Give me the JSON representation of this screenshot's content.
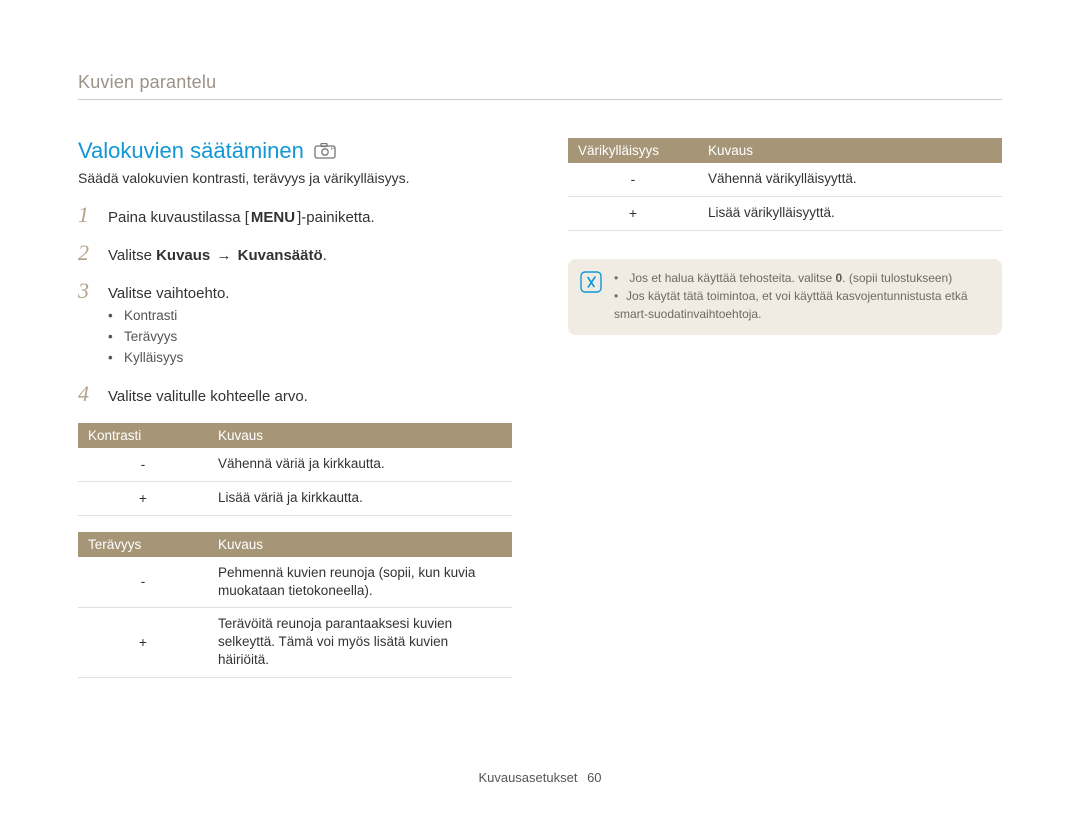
{
  "breadcrumb": "Kuvien parantelu",
  "section": {
    "title": "Valokuvien säätäminen"
  },
  "subtitle": "Säädä valokuvien kontrasti, terävyys ja värikylläisyys.",
  "steps": [
    {
      "num": "1",
      "pre": "Paina kuvaustilassa [",
      "badge": "MENU",
      "post": "]-painiketta."
    },
    {
      "num": "2",
      "pre": "Valitse ",
      "bold1": "Kuvaus",
      "arrow": "→",
      "bold2": "Kuvansäätö",
      "tail": "."
    },
    {
      "num": "3",
      "pre": "Valitse vaihtoehto.",
      "bullets": [
        "Kontrasti",
        "Terävyys",
        "Kylläisyys"
      ]
    },
    {
      "num": "4",
      "pre": "Valitse valitulle kohteelle arvo."
    }
  ],
  "tables": {
    "kontrasti": {
      "head1": "Kontrasti",
      "head2": "Kuvaus",
      "rows": [
        {
          "sign": "-",
          "desc": "Vähennä väriä ja kirkkautta."
        },
        {
          "sign": "+",
          "desc": "Lisää väriä ja kirkkautta."
        }
      ]
    },
    "teravyys": {
      "head1": "Terävyys",
      "head2": "Kuvaus",
      "rows": [
        {
          "sign": "-",
          "desc": "Pehmennä kuvien reunoja (sopii, kun kuvia muokataan tietokoneella)."
        },
        {
          "sign": "+",
          "desc": "Terävöitä reunoja parantaaksesi kuvien selkeyttä. Tämä voi myös lisätä kuvien häiriöitä."
        }
      ]
    },
    "vari": {
      "head1": "Värikylläisyys",
      "head2": "Kuvaus",
      "rows": [
        {
          "sign": "-",
          "desc": "Vähennä värikylläisyyttä."
        },
        {
          "sign": "+",
          "desc": "Lisää värikylläisyyttä."
        }
      ]
    }
  },
  "note": {
    "l1_pre": "Jos et halua käyttää tehosteita. valitse ",
    "l1_bold": "0",
    "l1_post": ". (sopii tulostukseen)",
    "l2": "Jos käytät tätä toimintoa, et voi käyttää kasvojentunnistusta etkä smart-suodatinvaihtoehtoja."
  },
  "footer": {
    "label": "Kuvausasetukset",
    "page": "60"
  }
}
